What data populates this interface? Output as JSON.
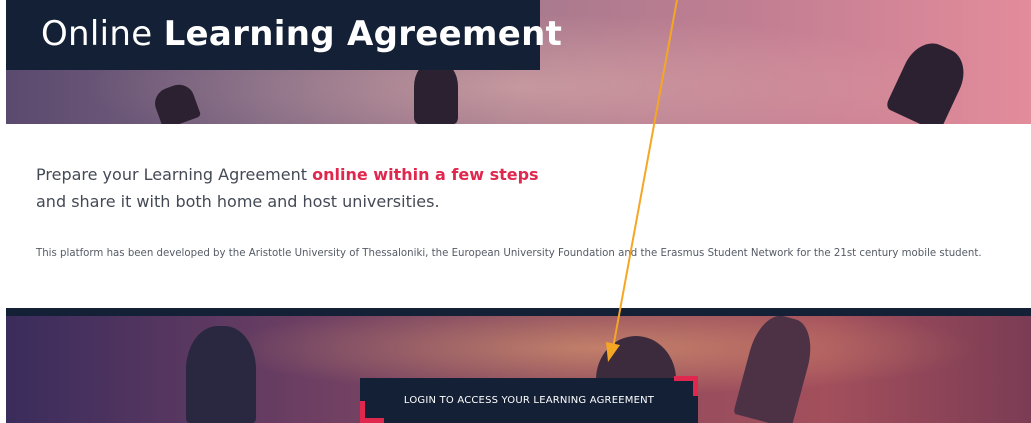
{
  "header": {
    "title_light": "Online",
    "title_bold": "Learning Agreement"
  },
  "intro": {
    "headline_prefix": "Prepare your Learning Agreement",
    "headline_highlight": "online within a few steps",
    "subline": "and share it with both home and host universities.",
    "note": "This platform has been developed by the Aristotle University of Thessaloniki, the European University Foundation and the Erasmus Student Network for the 21st century mobile student."
  },
  "login": {
    "button_label": "LOGIN TO ACCESS YOUR LEARNING AGREEMENT"
  },
  "colors": {
    "navy": "#142036",
    "accent": "#e0284f",
    "annotation_arrow": "#f5a623"
  }
}
